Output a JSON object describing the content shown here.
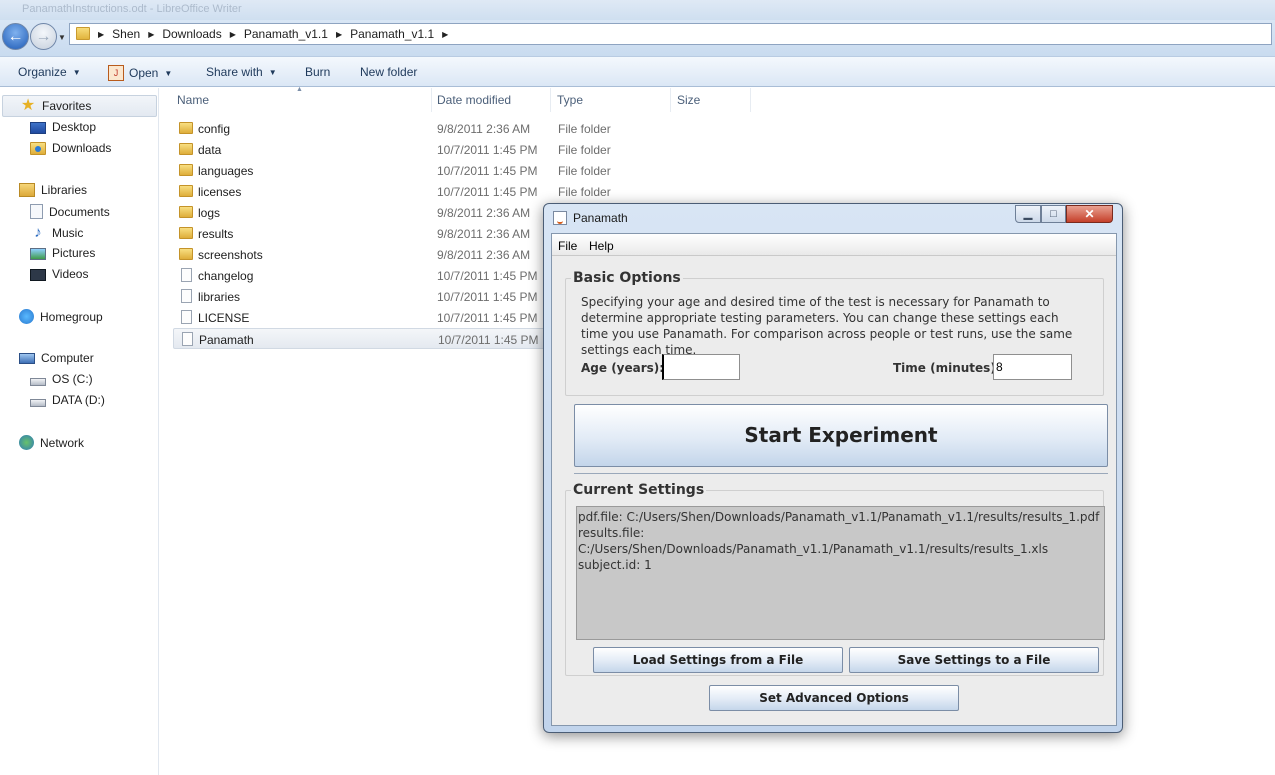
{
  "window": {
    "ghost_title": "PanamathInstructions.odt - LibreOffice Writer"
  },
  "address": {
    "crumbs": [
      "Shen",
      "Downloads",
      "Panamath_v1.1",
      "Panamath_v1.1"
    ]
  },
  "toolbar": {
    "organize": "Organize",
    "open": "Open",
    "share_with": "Share with",
    "burn": "Burn",
    "new_folder": "New folder"
  },
  "navpane": {
    "favorites": "Favorites",
    "desktop": "Desktop",
    "downloads": "Downloads",
    "libraries": "Libraries",
    "documents": "Documents",
    "music": "Music",
    "pictures": "Pictures",
    "videos": "Videos",
    "homegroup": "Homegroup",
    "computer": "Computer",
    "os_c": "OS (C:)",
    "data_d": "DATA (D:)",
    "network": "Network"
  },
  "columns": {
    "name": "Name",
    "date": "Date modified",
    "type": "Type",
    "size": "Size"
  },
  "files": [
    {
      "name": "config",
      "date": "9/8/2011 2:36 AM",
      "type": "File folder",
      "kind": "folder"
    },
    {
      "name": "data",
      "date": "10/7/2011 1:45 PM",
      "type": "File folder",
      "kind": "folder"
    },
    {
      "name": "languages",
      "date": "10/7/2011 1:45 PM",
      "type": "File folder",
      "kind": "folder"
    },
    {
      "name": "licenses",
      "date": "10/7/2011 1:45 PM",
      "type": "File folder",
      "kind": "folder"
    },
    {
      "name": "logs",
      "date": "9/8/2011 2:36 AM",
      "type": "File folder",
      "kind": "folder"
    },
    {
      "name": "results",
      "date": "9/8/2011 2:36 AM",
      "type": "File folder",
      "kind": "folder"
    },
    {
      "name": "screenshots",
      "date": "9/8/2011 2:36 AM",
      "type": "File folder",
      "kind": "folder"
    },
    {
      "name": "changelog",
      "date": "10/7/2011 1:45 PM",
      "type": "",
      "kind": "file"
    },
    {
      "name": "libraries",
      "date": "10/7/2011 1:45 PM",
      "type": "",
      "kind": "file"
    },
    {
      "name": "LICENSE",
      "date": "10/7/2011 1:45 PM",
      "type": "",
      "kind": "file"
    },
    {
      "name": "Panamath",
      "date": "10/7/2011 1:45 PM",
      "type": "",
      "kind": "file"
    }
  ],
  "dialog": {
    "title": "Panamath",
    "menu_file": "File",
    "menu_help": "Help",
    "basic_options_title": "Basic Options",
    "description": "Specifying your age and desired time of the test is necessary for Panamath to determine appropriate testing parameters. You can change these settings each time you use Panamath. For comparison across people or test runs, use the same settings each time.",
    "age_label": "Age (years):",
    "age_value": "",
    "time_label": "Time (minutes):",
    "time_value": "8",
    "start_button": "Start Experiment",
    "current_settings_title": "Current Settings",
    "settings_lines": [
      "pdf.file: C:/Users/Shen/Downloads/Panamath_v1.1/Panamath_v1.1/results/results_1.pdf",
      "results.file: C:/Users/Shen/Downloads/Panamath_v1.1/Panamath_v1.1/results/results_1.xls",
      "subject.id: 1"
    ],
    "load_button": "Load Settings from a File",
    "save_button": "Save Settings to a File",
    "advanced_button": "Set Advanced Options"
  },
  "colors": {
    "selection_bg": "#e4e9f0",
    "close_button": "#c5402a",
    "button_gradient_end": "#c3d5ea"
  }
}
